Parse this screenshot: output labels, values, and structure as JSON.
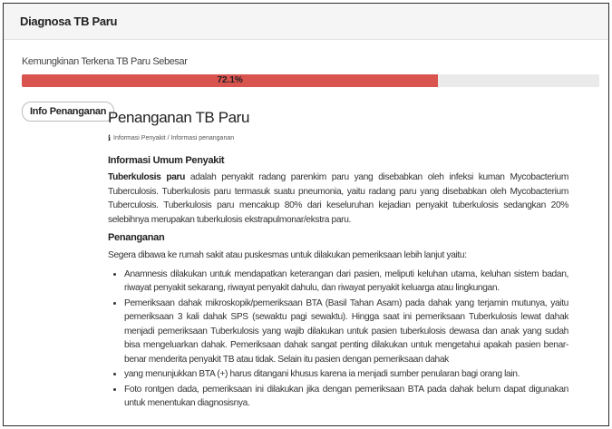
{
  "panel": {
    "title": "Diagnosa TB Paru"
  },
  "probability": {
    "label": "Kemungkinan Terkena TB Paru Sebesar",
    "text": "72.1%",
    "fraction": 0.721,
    "color": "#d9534f"
  },
  "button": {
    "label": "Info Penanganan"
  },
  "content": {
    "title": "Penanganan TB Paru",
    "breadcrumb": "Informasi Penyakit / Informasi penanganan",
    "section1_title": "Informasi Umum Penyakit",
    "section1_bold": "Tuberkulosis paru",
    "section1_text": " adalah penyakit radang parenkim paru yang disebabkan oleh infeksi kuman Mycobacterium Tuberculosis. Tuberkulosis paru termasuk suatu pneumonia, yaitu radang paru yang disebabkan oleh Mycobacterium Tuberculosis. Tuberkulosis paru mencakup 80% dari keseluruhan kejadian penyakit tuberkulosis sedangkan 20% selebihnya merupakan tuberkulosis ekstrapulmonar/ekstra paru.",
    "section2_title": "Penanganan",
    "section2_intro": "Segera dibawa ke rumah sakit atau puskesmas untuk dilakukan pemeriksaan lebih lanjut yaitu:",
    "items": [
      "Anamnesis dilakukan untuk mendapatkan keterangan dari pasien, meliputi keluhan utama, keluhan sistem badan, riwayat penyakit sekarang, riwayat penyakit dahulu, dan riwayat penyakit keluarga atau lingkungan.",
      "Pemeriksaan dahak mikroskopik/pemeriksaan BTA (Basil Tahan Asam) pada dahak yang terjamin mutunya, yaitu pemeriksaan 3 kali dahak SPS (sewaktu pagi sewaktu). Hingga saat ini pemeriksaan Tuberkulosis lewat dahak menjadi pemeriksaan Tuberkulosis yang wajib dilakukan untuk pasien tuberkulosis dewasa dan anak yang sudah bisa mengeluarkan dahak. Pemeriksaan dahak sangat penting dilakukan untuk mengetahui apakah pasien benar-benar menderita penyakit TB atau tidak. Selain itu pasien dengan pemeriksaan dahak",
      "yang menunjukkan BTA (+) harus ditangani khusus karena ia menjadi sumber penularan bagi orang lain.",
      "Foto rontgen dada, pemeriksaan ini dilakukan jika dengan pemeriksaan BTA pada dahak belum dapat digunakan untuk menentukan diagnosisnya."
    ]
  }
}
